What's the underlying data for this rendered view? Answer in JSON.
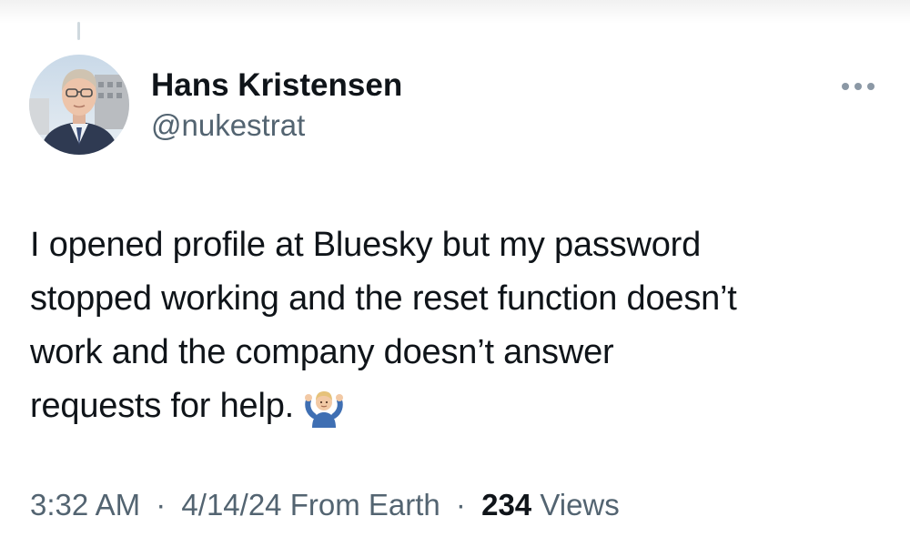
{
  "thread": {
    "has_parent_line": true
  },
  "author": {
    "name": "Hans Kristensen",
    "handle": "@nukestrat",
    "avatar_icon": "profile-photo-icon"
  },
  "header": {
    "more_icon": "more-horizontal-icon"
  },
  "tweet": {
    "lines": [
      "I opened profile at Bluesky but my password",
      "stopped working and the reset function doesn’t",
      "work and the company doesn’t answer",
      "requests for help."
    ],
    "emoji": "shrugging-person-icon"
  },
  "meta": {
    "time": "3:32 AM",
    "separator": "·",
    "date": "4/14/24",
    "source": "From Earth",
    "views_count": "234",
    "views_label": "Views"
  },
  "colors": {
    "text_primary": "#0f1419",
    "text_secondary": "#536471",
    "background": "#ffffff"
  }
}
